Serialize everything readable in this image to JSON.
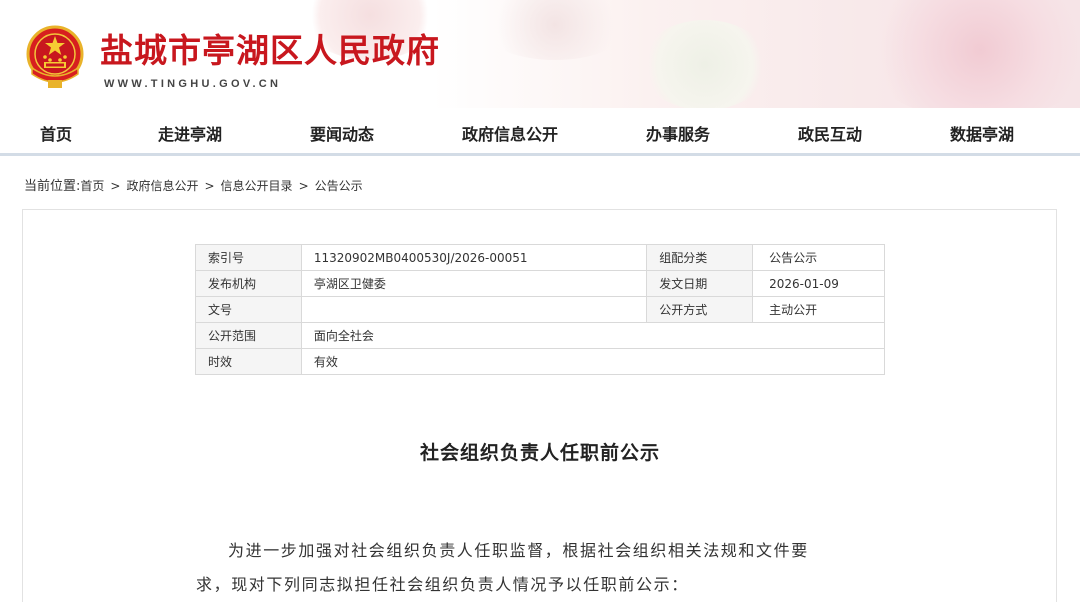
{
  "header": {
    "site_title": "盐城市亭湖区人民政府",
    "site_url": "WWW.TINGHU.GOV.CN",
    "emblem_icon": "national-emblem-icon"
  },
  "nav": {
    "items": [
      "首页",
      "走进亭湖",
      "要闻动态",
      "政府信息公开",
      "办事服务",
      "政民互动",
      "数据亭湖"
    ]
  },
  "breadcrumb": {
    "lead": "当前位置:",
    "items": [
      "首页",
      "政府信息公开",
      "信息公开目录",
      "公告公示"
    ],
    "separator": ">"
  },
  "meta": {
    "index_label": "索引号",
    "index_value": "11320902MB0400530J/2026-00051",
    "category_label": "组配分类",
    "category_value": "公告公示",
    "publisher_label": "发布机构",
    "publisher_value": "亭湖区卫健委",
    "date_label": "发文日期",
    "date_value": "2026-01-09",
    "docno_label": "文号",
    "docno_value": "",
    "method_label": "公开方式",
    "method_value": "主动公开",
    "scope_label": "公开范围",
    "scope_value": "面向全社会",
    "validity_label": "时效",
    "validity_value": "有效"
  },
  "document": {
    "title": "社会组织负责人任职前公示",
    "body": "为进一步加强对社会组织负责人任职监督，根据社会组织相关法规和文件要求，现对下列同志拟担任社会组织负责人情况予以任职前公示："
  },
  "colors": {
    "brand_red": "#c8171e",
    "nav_underline": "#d3dce6"
  }
}
